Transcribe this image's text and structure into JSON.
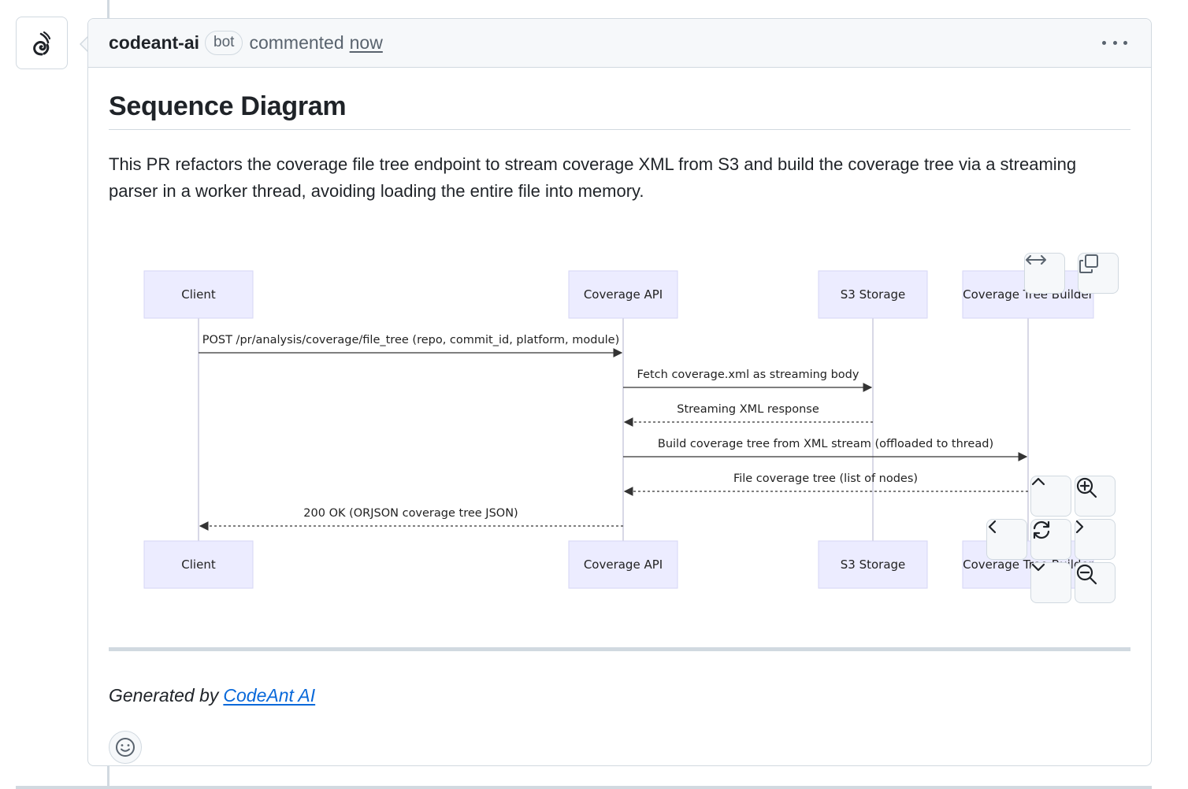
{
  "comment": {
    "author": "codeant-ai",
    "badge": "bot",
    "action": "commented",
    "time": "now"
  },
  "body": {
    "heading": "Sequence Diagram",
    "description": "This PR refactors the coverage file tree endpoint to stream coverage XML from S3 and build the coverage tree via a streaming parser in a worker thread, avoiding loading the entire file into memory.",
    "generated_prefix": "Generated by",
    "generated_link": "CodeAnt AI"
  },
  "diagram": {
    "participants": [
      "Client",
      "Coverage API",
      "S3 Storage",
      "Coverage Tree Builder"
    ],
    "messages": [
      {
        "from": 0,
        "to": 1,
        "label": "POST /pr/analysis/coverage/file_tree (repo, commit_id, platform, module)",
        "style": "solid"
      },
      {
        "from": 1,
        "to": 2,
        "label": "Fetch coverage.xml as streaming body",
        "style": "solid"
      },
      {
        "from": 2,
        "to": 1,
        "label": "Streaming XML response",
        "style": "dashed"
      },
      {
        "from": 1,
        "to": 3,
        "label": "Build coverage tree from XML stream (offloaded to thread)",
        "style": "solid"
      },
      {
        "from": 3,
        "to": 1,
        "label": "File coverage tree (list of nodes)",
        "style": "dashed"
      },
      {
        "from": 1,
        "to": 0,
        "label": "200 OK (ORJSON coverage tree JSON)",
        "style": "dashed"
      }
    ],
    "controls": {
      "expand": "expand-icon",
      "copy": "copy-icon",
      "pan_up": "chevron-up-icon",
      "pan_down": "chevron-down-icon",
      "pan_left": "chevron-left-icon",
      "pan_right": "chevron-right-icon",
      "reset": "reset-icon",
      "zoom_in": "zoom-in-icon",
      "zoom_out": "zoom-out-icon"
    }
  },
  "colors": {
    "participant_fill": "#ececff",
    "participant_stroke": "#d6d6f5",
    "link": "#0969da"
  }
}
